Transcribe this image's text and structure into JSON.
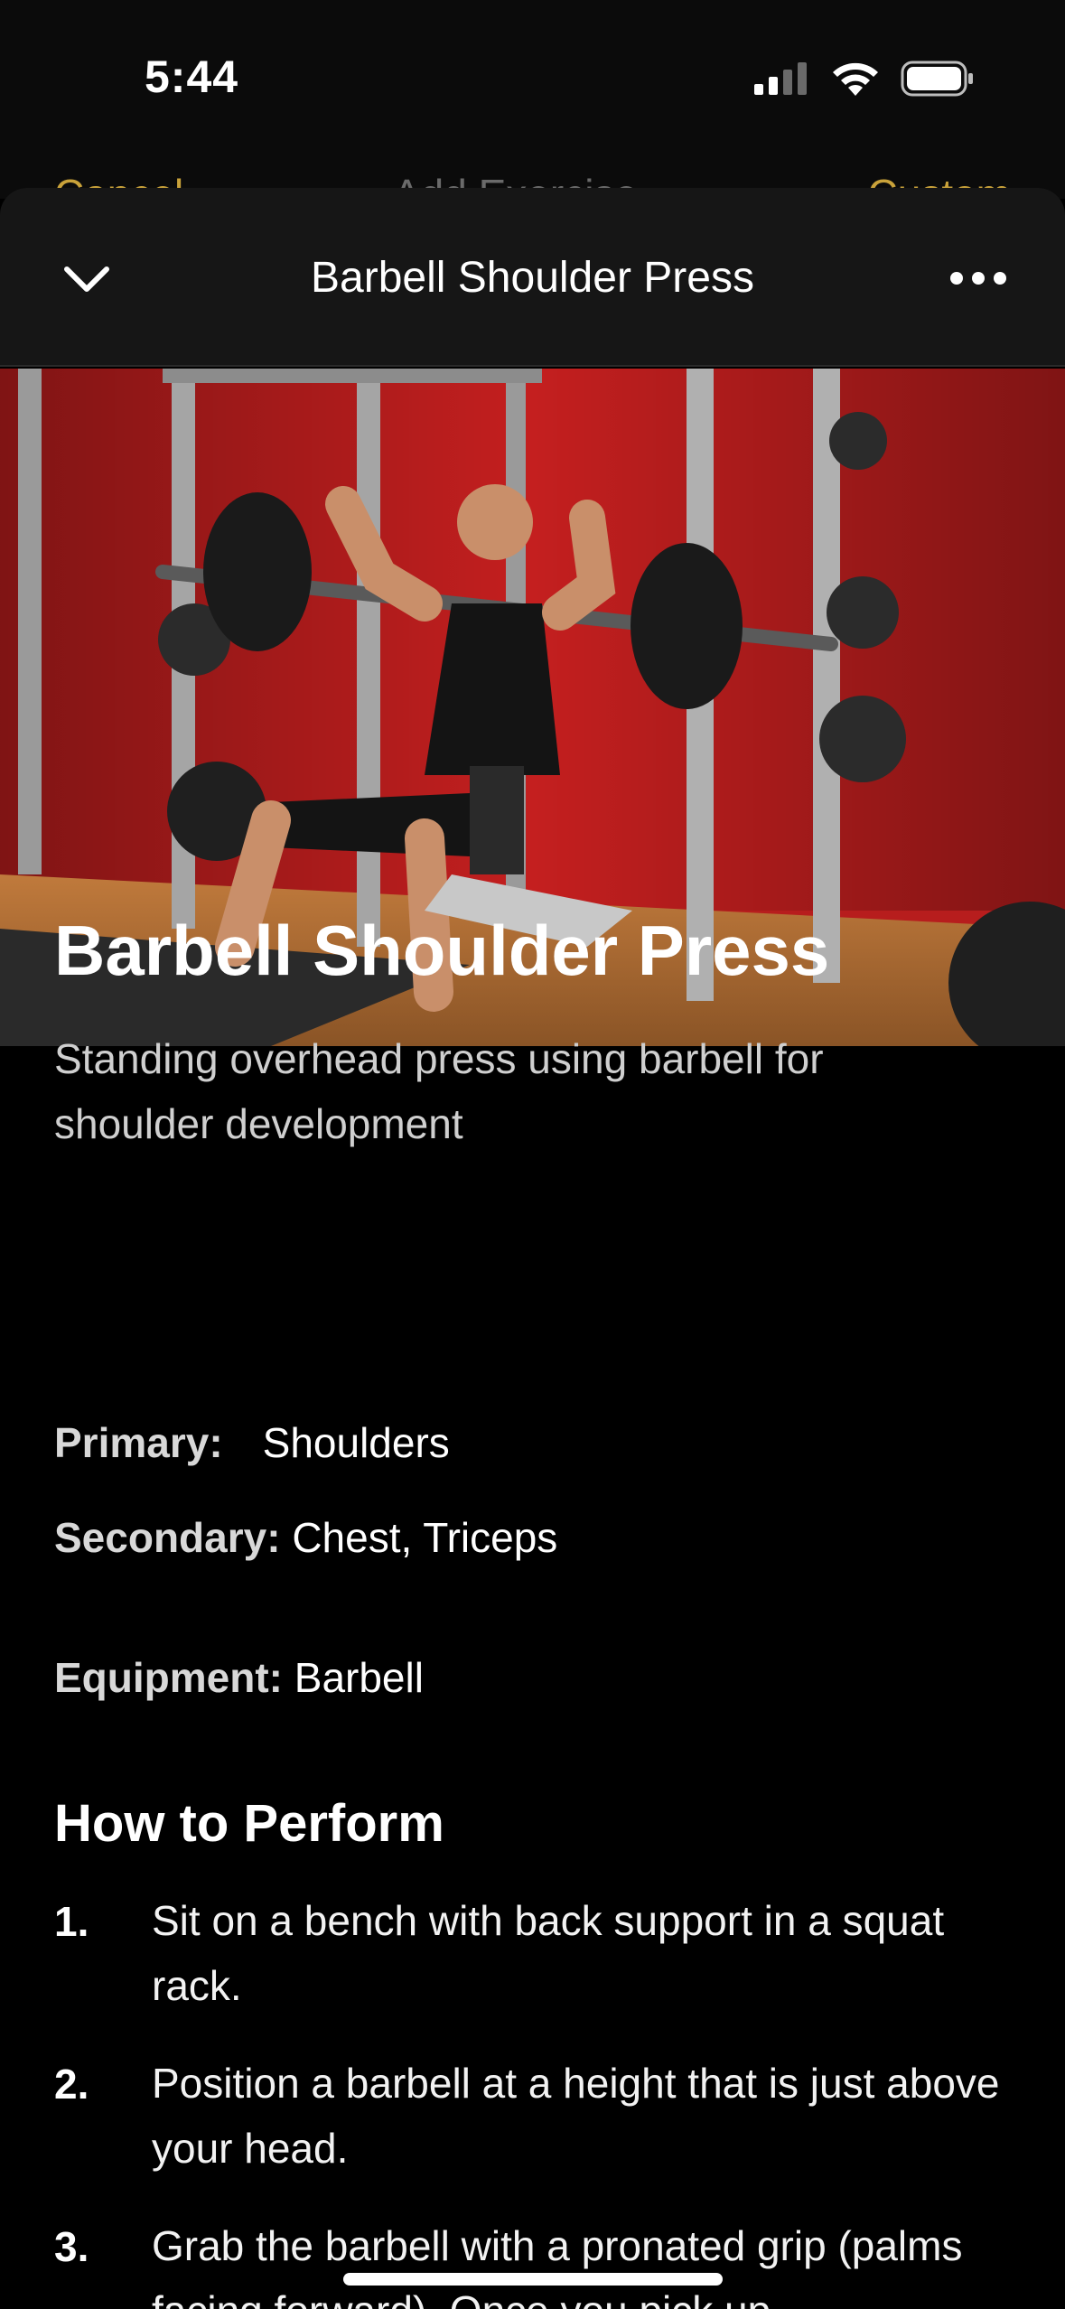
{
  "status_bar": {
    "time": "5:44",
    "signal_icon": "cellular-signal-icon",
    "wifi_icon": "wifi-icon",
    "battery_icon": "battery-icon"
  },
  "background_header": {
    "cancel": "Cancel",
    "title": "Add Exercise",
    "custom": "Custom"
  },
  "sheet": {
    "title": "Barbell Shoulder Press",
    "collapse_icon": "chevron-down-icon",
    "more_icon": "ellipsis-icon"
  },
  "exercise": {
    "name": "Barbell Shoulder Press",
    "description": "Standing overhead press using barbell for shoulder development",
    "primary_label": "Primary:",
    "primary_value": "Shoulders",
    "secondary_label": "Secondary:",
    "secondary_value": "Chest, Triceps",
    "equipment_label": "Equipment:",
    "equipment_value": "Barbell"
  },
  "how_to": {
    "title": "How to Perform",
    "steps": [
      {
        "num": "1.",
        "text": "Sit on a bench with back support in a squat rack."
      },
      {
        "num": "2.",
        "text": "Position a barbell at a height that is just above your head."
      },
      {
        "num": "3.",
        "text": "Grab the barbell with a pronated grip (palms facing forward). Once you pick up"
      }
    ]
  },
  "colors": {
    "accent": "#c9a23a",
    "background": "#000000",
    "nav": "#161616"
  }
}
